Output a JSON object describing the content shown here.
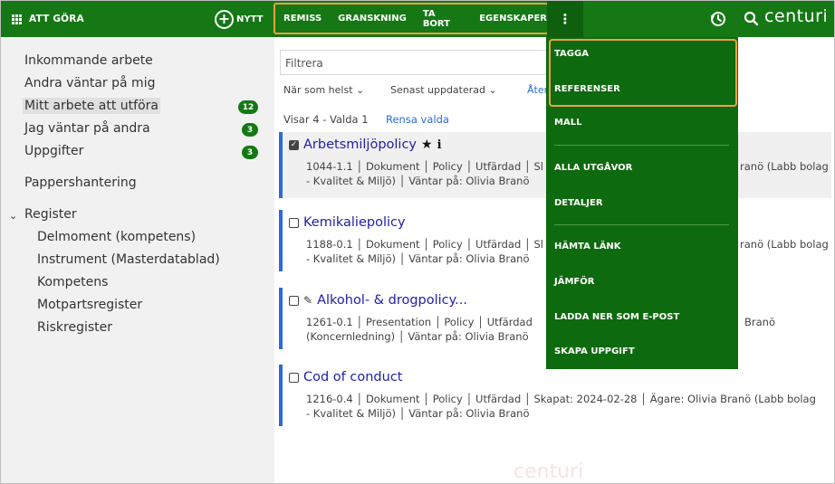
{
  "header": {
    "app_title": "ATT GÖRA",
    "new_label": "NYTT",
    "actions": [
      "REMISS",
      "GRANSKNING",
      "TA BORT",
      "EGENSKAPER"
    ],
    "more_label": "⋮",
    "logo_text": "centuri",
    "accent_color": "#157815",
    "highlight_color": "#f0a040"
  },
  "sidebar": {
    "items": [
      {
        "label": "Inkommande arbete"
      },
      {
        "label": "Andra väntar på mig"
      },
      {
        "label": "Mitt arbete att utföra",
        "badge": "12"
      },
      {
        "label": "Jag väntar på andra",
        "badge": "3"
      },
      {
        "label": "Uppgifter",
        "badge": "3"
      },
      {
        "label": "Pappershantering"
      }
    ],
    "register": {
      "label": "Register",
      "children": [
        "Delmoment (kompetens)",
        "Instrument (Masterdatablad)",
        "Kompetens",
        "Motpartsregister",
        "Riskregister"
      ]
    }
  },
  "main": {
    "filter_placeholder": "Filtrera",
    "dropdowns": [
      "När som helst",
      "Senast uppdaterad",
      "Åter"
    ],
    "count_text": "Visar 4 - Valda 1",
    "clear_label": "Rensa valda",
    "documents": [
      {
        "title": "Arbetsmiljöpolicy",
        "line1": "1044-1.1 │ Dokument │ Policy │ Utfärdad │ Sl",
        "line1_tail": "ranö (Labb bolag",
        "line2": "- Kvalitet & Miljö) │ Väntar på: Olivia Branö",
        "checked": true
      },
      {
        "title": "Kemikaliepolicy",
        "line1": "1188-0.1 │ Dokument │ Policy │ Utfärdad │ Sl",
        "line1_tail": "ranö (Labb bolag",
        "line2": "- Kvalitet & Miljö) │ Väntar på: Olivia Branö",
        "checked": false
      },
      {
        "title": "Alkohol- & drogpolicy...",
        "line1": "1261-0.1 │ Presentation │ Policy │ Utfärdad",
        "line1_tail": "Branö",
        "line2": "(Koncernledning) │ Väntar på: Olivia Branö",
        "checked": false
      },
      {
        "title": "Cod of conduct",
        "line1": "1216-0.4 │ Dokument │ Policy │ Utfärdad │ Skapat: 2024-02-28 │ Ägare: Olivia Branö (Labb bolag",
        "line2": "- Kvalitet & Miljö) │ Väntar på: Olivia Branö",
        "checked": false
      }
    ]
  },
  "menu": {
    "items": [
      "TAGGA",
      "REFERENSER",
      "MALL",
      "ALLA UTGÅVOR",
      "DETALJER",
      "HÄMTA LÄNK",
      "JÄMFÖR",
      "LADDA NER SOM E-POST",
      "SKAPA UPPGIFT"
    ]
  },
  "watermark": "centuri"
}
